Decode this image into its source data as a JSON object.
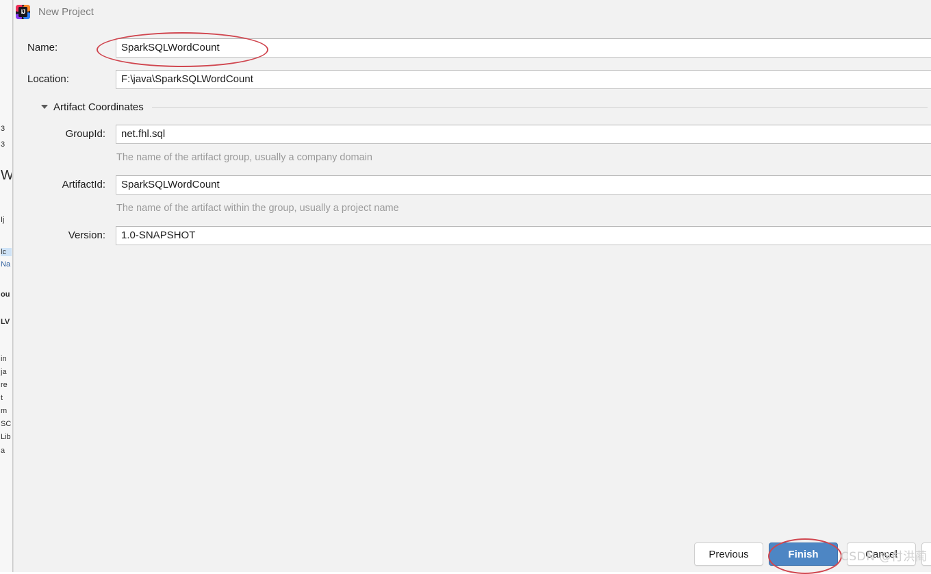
{
  "window": {
    "title": "New Project",
    "icon": "intellij-idea-icon",
    "icon_letters": "IJ"
  },
  "form": {
    "name": {
      "label": "Name:",
      "value": "SparkSQLWordCount",
      "placeholder": ""
    },
    "location": {
      "label": "Location:",
      "value": "F:\\java\\SparkSQLWordCount",
      "placeholder": ""
    }
  },
  "section": {
    "label": "Artifact Coordinates",
    "expanded": true,
    "arrow_icon": "chevron-down-icon",
    "fields": {
      "group_id": {
        "label": "GroupId:",
        "value": "net.fhl.sql",
        "hint": "The name of the artifact group, usually a company domain"
      },
      "artifact_id": {
        "label": "ArtifactId:",
        "value": "SparkSQLWordCount",
        "hint": "The name of the artifact within the group, usually a project name"
      },
      "version": {
        "label": "Version:",
        "value": "1.0-SNAPSHOT",
        "hint": ""
      }
    }
  },
  "buttons": {
    "previous": "Previous",
    "finish": "Finish",
    "cancel": "Cancel",
    "help": ""
  },
  "annotations": {
    "color": "#d0464f",
    "name_circle": "red-ellipse-around-name-field",
    "finish_circle": "red-ellipse-around-finish-button"
  },
  "watermark": {
    "text": "CSDN @付洪蔺"
  },
  "colors": {
    "dialog_background": "#f2f2f2",
    "input_background": "#ffffff",
    "primary_button": "#4d86c4",
    "hint_text": "#9a9a9a",
    "title_text": "#7a7a7a"
  },
  "background_sliver": {
    "fragments": [
      "3",
      "3",
      "W",
      "Ij",
      "lc",
      "Na",
      "ou",
      "LV",
      "in",
      "ja",
      "re",
      "t",
      "m",
      "SC",
      "Lib",
      "a"
    ]
  }
}
